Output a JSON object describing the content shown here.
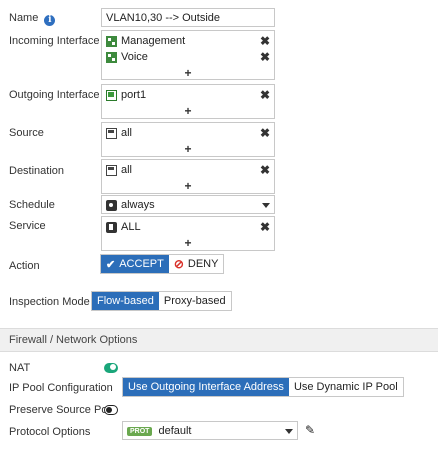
{
  "name": {
    "label": "Name",
    "value": "VLAN10,30 --> Outside"
  },
  "incoming": {
    "label": "Incoming Interface",
    "items": [
      "Management",
      "Voice"
    ]
  },
  "outgoing": {
    "label": "Outgoing Interface",
    "items": [
      "port1"
    ]
  },
  "source": {
    "label": "Source",
    "items": [
      "all"
    ]
  },
  "destination": {
    "label": "Destination",
    "items": [
      "all"
    ]
  },
  "schedule": {
    "label": "Schedule",
    "value": "always"
  },
  "service": {
    "label": "Service",
    "items": [
      "ALL"
    ]
  },
  "action": {
    "label": "Action",
    "accept": "ACCEPT",
    "deny": "DENY",
    "selected": "ACCEPT"
  },
  "inspection": {
    "label": "Inspection Mode",
    "flow": "Flow-based",
    "proxy": "Proxy-based",
    "selected": "Flow-based"
  },
  "firewall_section": {
    "title": "Firewall / Network Options"
  },
  "nat": {
    "label": "NAT",
    "enabled": true
  },
  "ip_pool": {
    "label": "IP Pool Configuration",
    "opt_outgoing": "Use Outgoing Interface Address",
    "opt_dynamic": "Use Dynamic IP Pool",
    "selected": "Use Outgoing Interface Address"
  },
  "preserve_port": {
    "label": "Preserve Source Port",
    "enabled": false
  },
  "protocol_options": {
    "label": "Protocol Options",
    "badge": "PROT",
    "value": "default"
  },
  "icons": {
    "remove": "close-icon",
    "add": "plus-icon",
    "edit": "pencil-icon",
    "info": "info-icon"
  },
  "colors": {
    "accent": "#2c6eb9",
    "toggle_on": "#1aa67a",
    "deny": "#d9312a",
    "prot_badge": "#6aa84f"
  }
}
